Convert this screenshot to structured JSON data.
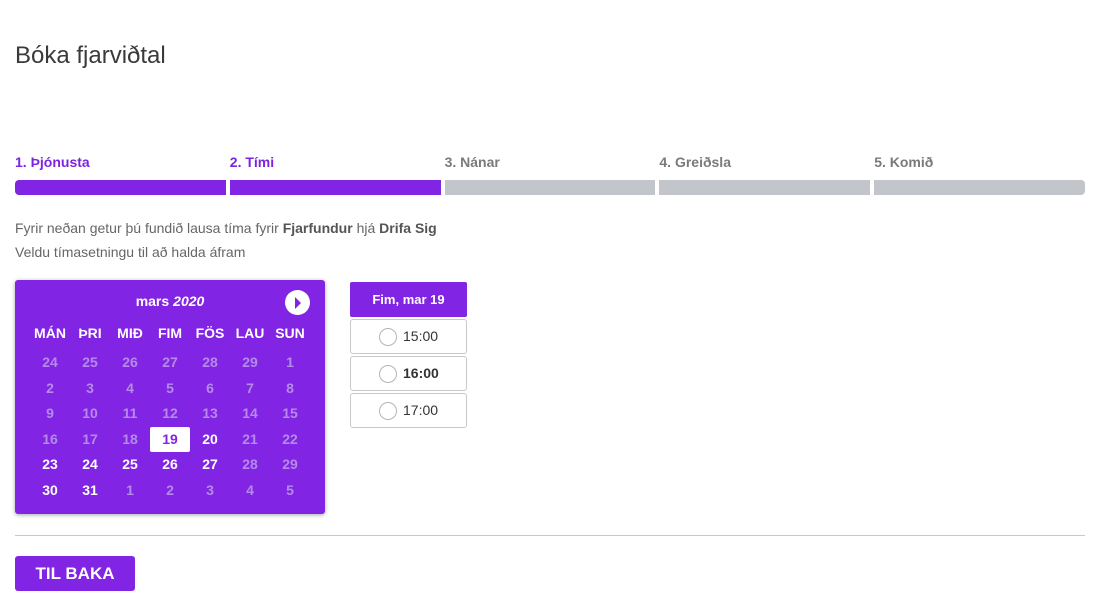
{
  "page": {
    "title": "Bóka fjarviðtal"
  },
  "steps": [
    {
      "label": "1. Þjónusta",
      "active": true
    },
    {
      "label": "2. Tími",
      "active": true
    },
    {
      "label": "3. Nánar",
      "active": false
    },
    {
      "label": "4. Greiðsla",
      "active": false
    },
    {
      "label": "5. Komið",
      "active": false
    }
  ],
  "intro": {
    "line1_prefix": "Fyrir neðan getur þú fundið lausa tíma fyrir ",
    "service": "Fjarfundur",
    "line1_mid": " hjá ",
    "provider": "Drifa Sig",
    "line2": "Veldu tímasetningu til að halda áfram"
  },
  "calendar": {
    "month": "mars",
    "year": "2020",
    "next_icon": "next-month-arrow-icon",
    "weekdays": [
      "MÁN",
      "ÞRI",
      "MIÐ",
      "FIM",
      "FÖS",
      "LAU",
      "SUN"
    ],
    "days": [
      {
        "d": "24",
        "s": "muted"
      },
      {
        "d": "25",
        "s": "muted"
      },
      {
        "d": "26",
        "s": "muted"
      },
      {
        "d": "27",
        "s": "muted"
      },
      {
        "d": "28",
        "s": "muted"
      },
      {
        "d": "29",
        "s": "muted"
      },
      {
        "d": "1",
        "s": "muted"
      },
      {
        "d": "2",
        "s": "muted"
      },
      {
        "d": "3",
        "s": "muted"
      },
      {
        "d": "4",
        "s": "muted"
      },
      {
        "d": "5",
        "s": "muted"
      },
      {
        "d": "6",
        "s": "muted"
      },
      {
        "d": "7",
        "s": "muted"
      },
      {
        "d": "8",
        "s": "muted"
      },
      {
        "d": "9",
        "s": "muted"
      },
      {
        "d": "10",
        "s": "muted"
      },
      {
        "d": "11",
        "s": "muted"
      },
      {
        "d": "12",
        "s": "muted"
      },
      {
        "d": "13",
        "s": "muted"
      },
      {
        "d": "14",
        "s": "muted"
      },
      {
        "d": "15",
        "s": "muted"
      },
      {
        "d": "16",
        "s": "muted"
      },
      {
        "d": "17",
        "s": "muted"
      },
      {
        "d": "18",
        "s": "muted"
      },
      {
        "d": "19",
        "s": "selected"
      },
      {
        "d": "20",
        "s": "avail"
      },
      {
        "d": "21",
        "s": "muted"
      },
      {
        "d": "22",
        "s": "muted"
      },
      {
        "d": "23",
        "s": "avail"
      },
      {
        "d": "24",
        "s": "avail"
      },
      {
        "d": "25",
        "s": "avail"
      },
      {
        "d": "26",
        "s": "avail"
      },
      {
        "d": "27",
        "s": "avail"
      },
      {
        "d": "28",
        "s": "muted"
      },
      {
        "d": "29",
        "s": "muted"
      },
      {
        "d": "30",
        "s": "avail"
      },
      {
        "d": "31",
        "s": "avail"
      },
      {
        "d": "1",
        "s": "muted"
      },
      {
        "d": "2",
        "s": "muted"
      },
      {
        "d": "3",
        "s": "muted"
      },
      {
        "d": "4",
        "s": "muted"
      },
      {
        "d": "5",
        "s": "muted"
      }
    ]
  },
  "slots": {
    "header": "Fim, mar 19",
    "times": [
      {
        "label": "15:00",
        "bold": false
      },
      {
        "label": "16:00",
        "bold": true
      },
      {
        "label": "17:00",
        "bold": false
      }
    ]
  },
  "buttons": {
    "back": "TIL BAKA"
  },
  "colors": {
    "accent": "#8224e3",
    "inactive_bar": "#c2c6ca",
    "muted_day": "#b58be9"
  }
}
